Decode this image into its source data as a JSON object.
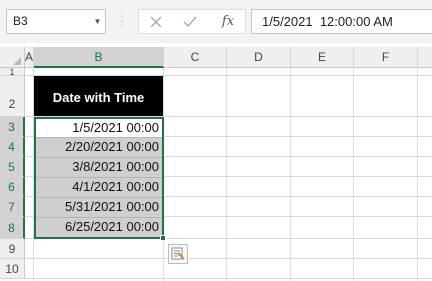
{
  "name_box": {
    "value": "B3",
    "icon": "chevron-down-icon"
  },
  "formula_bar": {
    "cancel_icon": "x-icon",
    "enter_icon": "checkmark-icon",
    "function_label": "fx",
    "content": "1/5/2021  12:00:00 AM"
  },
  "column_headers": [
    "A",
    "B",
    "C",
    "D",
    "E",
    "F"
  ],
  "selected_column": "B",
  "row_headers": [
    "1",
    "2",
    "3",
    "4",
    "5",
    "6",
    "7",
    "8",
    "9",
    "10"
  ],
  "sheet": {
    "header_cell": "Date with Time",
    "dates": [
      "1/5/2021 00:00",
      "2/20/2021 00:00",
      "3/8/2021 00:00",
      "4/1/2021 00:00",
      "5/31/2021 00:00",
      "6/25/2021 00:00"
    ]
  },
  "colors": {
    "selection": "#217346",
    "header_fill": "#000000",
    "selected_fill": "#cfcfcf"
  },
  "quick_analysis_icon": "quick-analysis-icon"
}
